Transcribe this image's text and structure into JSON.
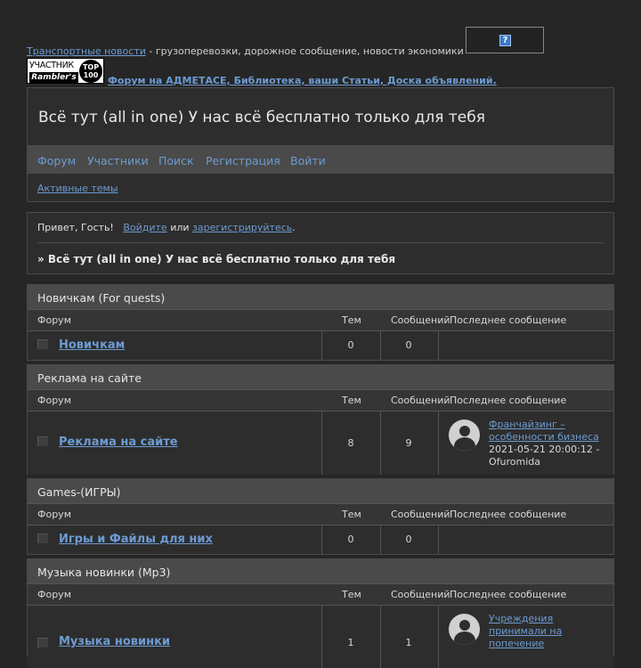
{
  "topbar": {
    "link_text": "Транспортные новости",
    "tail_text": " - грузоперевозки, дорожное сообщение, новости экономики",
    "help_icon": "?"
  },
  "rambler": {
    "line1": "УЧАСТНИК",
    "line2": "Rambler's",
    "circle": "TOP 100"
  },
  "ad_link": "Форум на АДМЕТАСЕ, Библиотека, ваши Статьи, Доска объявлений.",
  "header": {
    "title": "Всё тут (all in one) У нас всё бесплатно только для тебя",
    "nav": [
      "Форум",
      "Участники",
      "Поиск",
      "Регистрация",
      "Войти"
    ],
    "sub_link": "Активные темы"
  },
  "welcome": {
    "greeting": "Привет, Гость!",
    "login_link": "Войдите",
    "or_text": "или",
    "register_link": "зарегистрируйтесь",
    "period": ".",
    "breadcrumb": "» Всё тут (all in one) У нас всё бесплатно только для тебя"
  },
  "columns": {
    "forum": "Форум",
    "topics": "Тем",
    "posts": "Сообщений",
    "last": "Последнее сообщение"
  },
  "categories": [
    {
      "name": "Новичкам (For quests)",
      "forum": "Новичкам",
      "topics": "0",
      "posts": "0",
      "last_title": "",
      "last_meta": ""
    },
    {
      "name": "Реклама на сайте",
      "forum": "Реклама на сайте",
      "topics": "8",
      "posts": "9",
      "last_title": "Франчайзинг – особенности бизнеса",
      "last_meta": "2021-05-21 20:00:12 - Ofuromida"
    },
    {
      "name": "Games-(ИГРЫ)",
      "forum": "Игры и Файлы для них",
      "topics": "0",
      "posts": "0",
      "last_title": "",
      "last_meta": ""
    },
    {
      "name": "Музыка новинки (Mp3)",
      "forum": "Музыка новинки",
      "topics": "1",
      "posts": "1",
      "last_title": "Учреждения принимали на попечение",
      "last_meta": ""
    }
  ]
}
